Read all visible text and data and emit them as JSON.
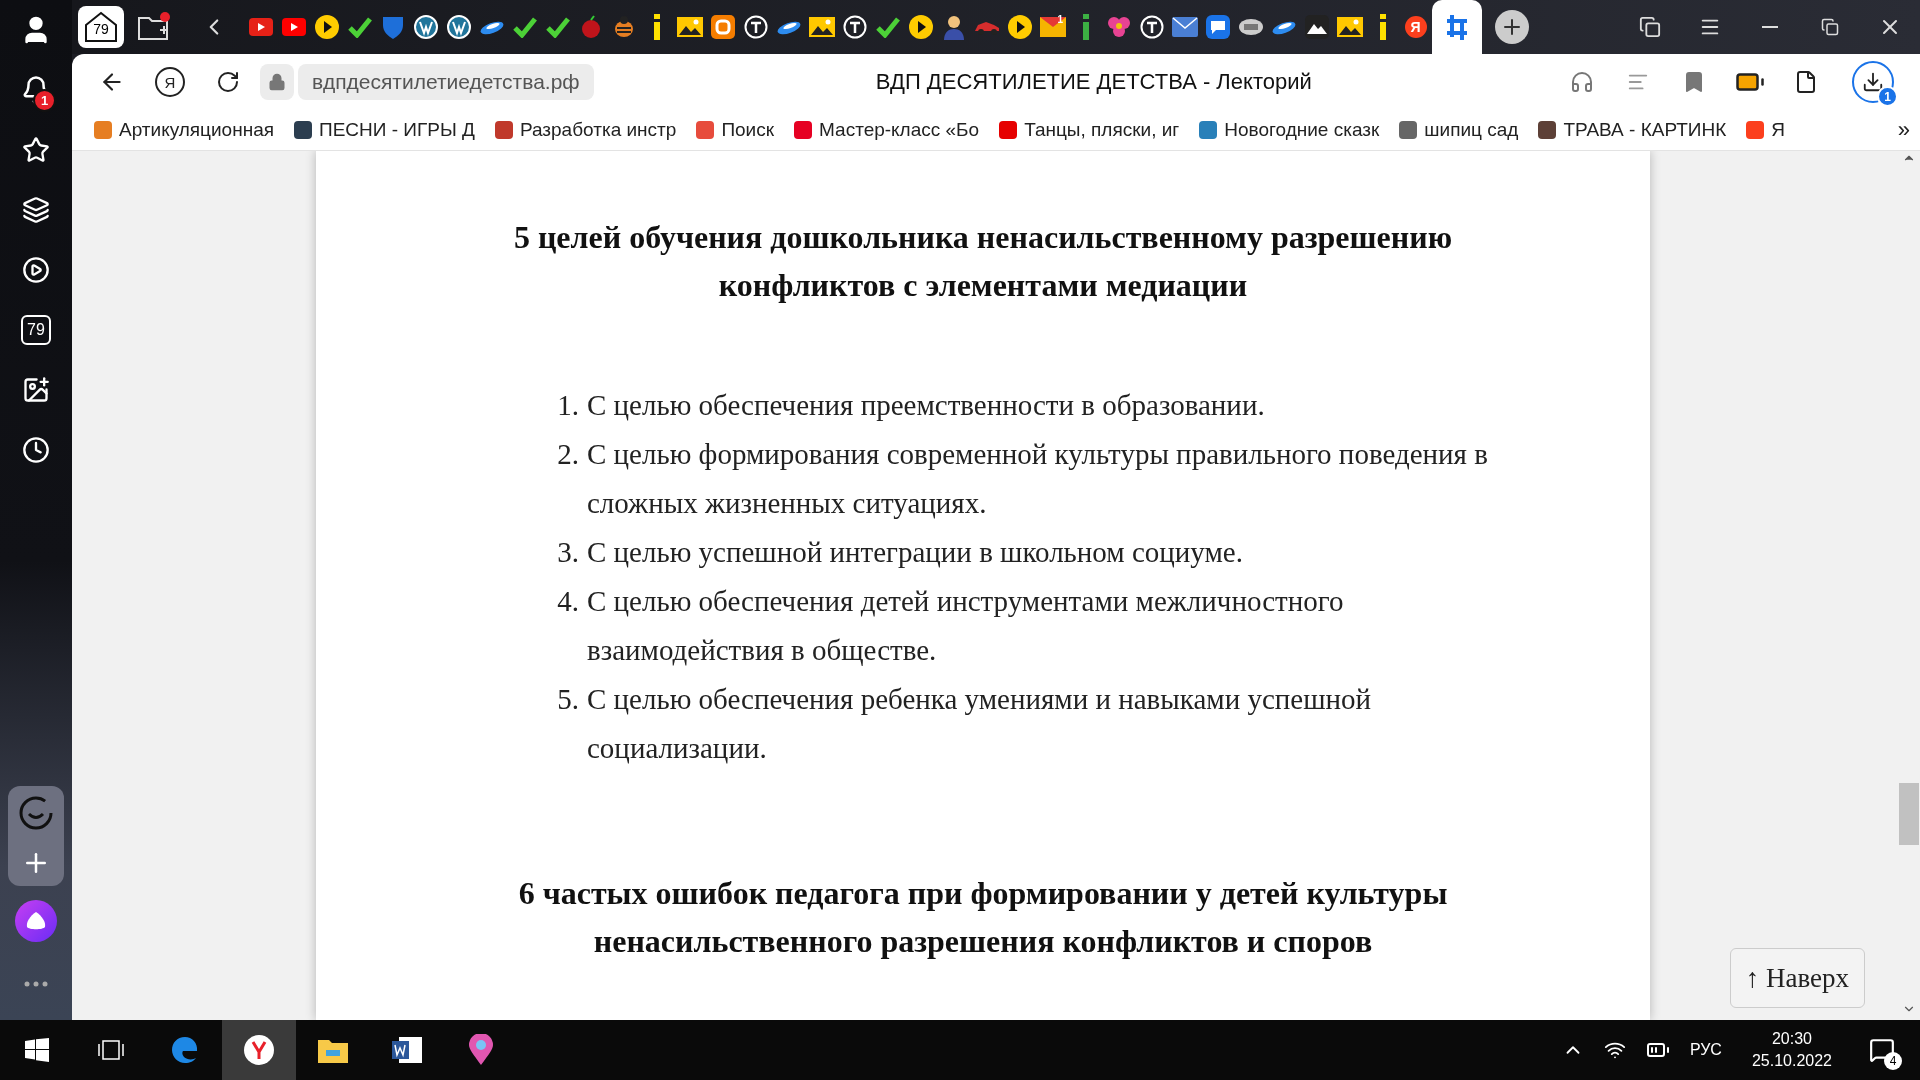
{
  "sidebar": {
    "notifications_badge": "1",
    "tabs_count": "79"
  },
  "tab_strip": {
    "home_count": "79",
    "tabs": [
      {
        "kind": "video",
        "color": "#e62117",
        "selected": false
      },
      {
        "kind": "video",
        "color": "#ff0000",
        "selected": false
      },
      {
        "kind": "play",
        "color": "#ffcc00",
        "selected": false
      },
      {
        "kind": "check",
        "color": "#4cd137",
        "selected": false
      },
      {
        "kind": "shield",
        "color": "#1e6fd9",
        "selected": false
      },
      {
        "kind": "wp",
        "color": "#21759b",
        "selected": false
      },
      {
        "kind": "wp",
        "color": "#21759b",
        "selected": false
      },
      {
        "kind": "swoosh",
        "color": "#2d8cf0",
        "selected": false
      },
      {
        "kind": "check",
        "color": "#4cd137",
        "selected": false
      },
      {
        "kind": "check",
        "color": "#4cd137",
        "selected": false
      },
      {
        "kind": "fruit",
        "color": "#c0141b",
        "selected": false
      },
      {
        "kind": "bug",
        "color": "#e67e22",
        "selected": false
      },
      {
        "kind": "info",
        "color": "#ffe100",
        "selected": false
      },
      {
        "kind": "image",
        "color": "#ffc800",
        "selected": false
      },
      {
        "kind": "blog",
        "color": "#f57d00",
        "selected": false
      },
      {
        "kind": "t",
        "color": "#ffffff",
        "selected": false
      },
      {
        "kind": "swoosh",
        "color": "#2d8cf0",
        "selected": false
      },
      {
        "kind": "image",
        "color": "#ffc800",
        "selected": false
      },
      {
        "kind": "t",
        "color": "#ffffff",
        "selected": false
      },
      {
        "kind": "check",
        "color": "#4cd137",
        "selected": false
      },
      {
        "kind": "play",
        "color": "#ffcc00",
        "selected": false
      },
      {
        "kind": "person",
        "color": "#3a4fa8",
        "selected": false
      },
      {
        "kind": "car",
        "color": "#d62d2d",
        "selected": false
      },
      {
        "kind": "play",
        "color": "#ffcc00",
        "selected": false
      },
      {
        "kind": "mail",
        "color": "#f5b400",
        "badge": "1",
        "selected": false
      },
      {
        "kind": "info",
        "color": "#3cb043",
        "selected": false
      },
      {
        "kind": "flower",
        "color": "#e84393",
        "selected": false
      },
      {
        "kind": "t",
        "color": "#ffffff",
        "selected": false
      },
      {
        "kind": "envelope",
        "color": "#4a7fd4",
        "selected": false
      },
      {
        "kind": "chat",
        "color": "#1a73e8",
        "selected": false
      },
      {
        "kind": "oval",
        "color": "#cccccc",
        "selected": false
      },
      {
        "kind": "swoosh",
        "color": "#2d8cf0",
        "selected": false
      },
      {
        "kind": "mountain",
        "color": "#222222",
        "selected": false
      },
      {
        "kind": "image",
        "color": "#ffc800",
        "selected": false
      },
      {
        "kind": "info",
        "color": "#ffe100",
        "selected": false
      },
      {
        "kind": "ya",
        "color": "#fc3f1d",
        "label": "Я",
        "selected": false
      },
      {
        "kind": "active",
        "color": "#1a73e8",
        "selected": true
      }
    ]
  },
  "address_bar": {
    "url": "вдпдесятилетиедетства.рф",
    "title": "ВДП ДЕСЯТИЛЕТИЕ ДЕТСТВА - Лекторий",
    "downloads_badge": "1",
    "search_logo": "Я"
  },
  "bookmarks": [
    {
      "label": "Артикуляционная",
      "color": "#e67e22"
    },
    {
      "label": "ПЕСНИ - ИГРЫ Д",
      "color": "#2c3e50"
    },
    {
      "label": "Разработка инстр",
      "color": "#c0392b"
    },
    {
      "label": "Поиск",
      "color": "#e74c3c"
    },
    {
      "label": "Мастер-класс «Бо",
      "color": "#e60023"
    },
    {
      "label": "Танцы, пляски, иг",
      "color": "#e60000"
    },
    {
      "label": "Новогодние сказк",
      "color": "#2980b9"
    },
    {
      "label": "шипиц сад",
      "color": "#666666"
    },
    {
      "label": "ТРАВА - КАРТИНК",
      "color": "#5d4037"
    },
    {
      "label": "Я",
      "color": "#fc3f1d"
    }
  ],
  "bookmarks_more": "»",
  "article": {
    "heading": "5 целей обучения дошкольника ненасильственному разрешению конфликтов с элементами медиации",
    "goals": [
      {
        "number": "1.",
        "text": "С целью обеспечения преемственности в образовании."
      },
      {
        "number": "2.",
        "text": "С целью формирования современной культуры правильного поведения в сложных жизненных ситуациях."
      },
      {
        "number": "3.",
        "text": "С целью успешной интеграции в школьном социуме."
      },
      {
        "number": "4.",
        "text": "С целью обеспечения детей инструментами межличностного взаимодействия в обществе."
      },
      {
        "number": "5.",
        "text": "С целью обеспечения ребенка умениями и навыками успешной социализации."
      }
    ],
    "heading_2": "6 частых ошибок педагога при формировании у детей культуры ненасильственного разрешения конфликтов и споров"
  },
  "back_to_top": "↑ Наверх",
  "taskbar": {
    "language": "РУС",
    "time": "20:30",
    "date": "25.10.2022",
    "notifications_badge": "4"
  }
}
